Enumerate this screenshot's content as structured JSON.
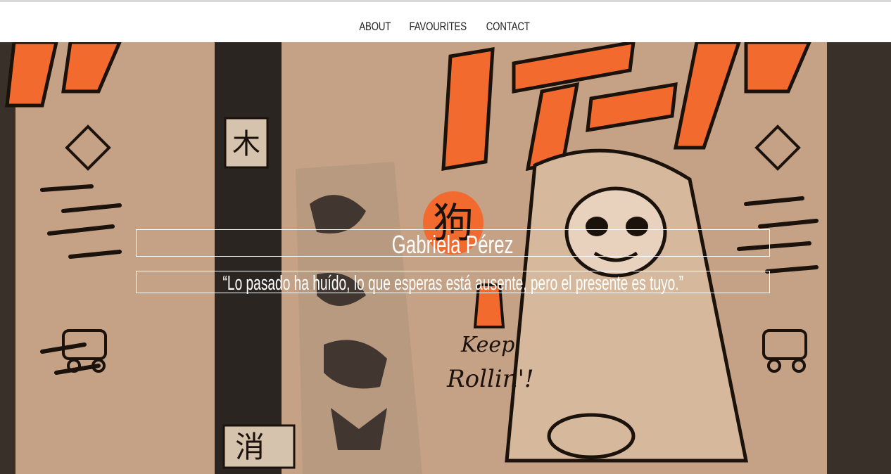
{
  "nav": {
    "items": [
      {
        "label": "ABOUT"
      },
      {
        "label": "FAVOURITES"
      },
      {
        "label": "CONTACT"
      }
    ]
  },
  "hero": {
    "background_color": "#c5a286",
    "accent_color": "#f26a2e",
    "ink_color": "#1b120c",
    "emblem_glyph": "狗",
    "name": "Gabriela Pérez",
    "quote": "“Lo pasado ha huído, lo que esperas está ausente, pero el presente es tuyo.”",
    "artwork_text": {
      "banner": "イエーツ!!",
      "kanji_left": "木",
      "kanji_bottom": "消",
      "slogan_line1": "Keep",
      "slogan_line2": "Rollin'!"
    }
  }
}
